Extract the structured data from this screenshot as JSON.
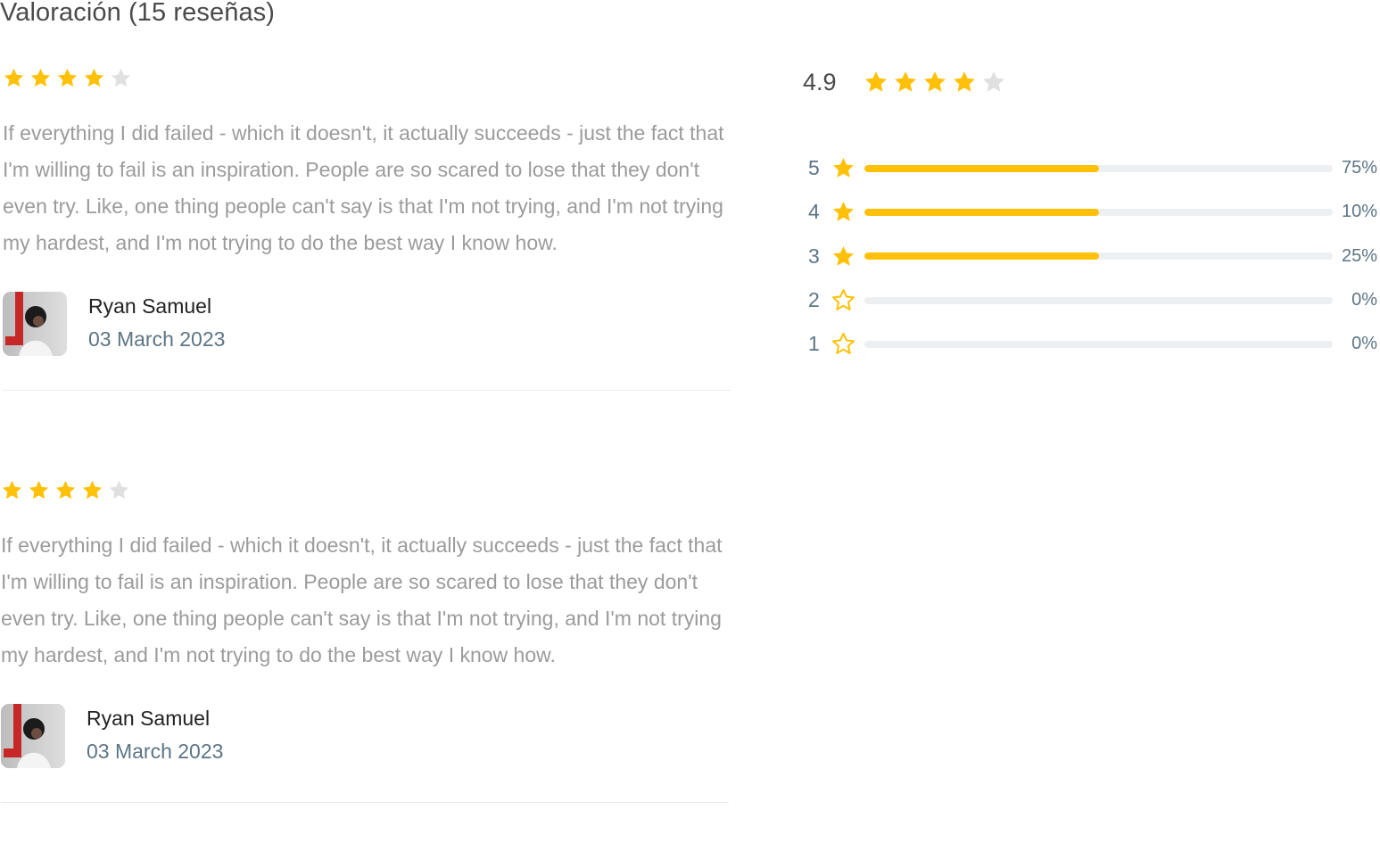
{
  "section": {
    "title": "Valoración (15 reseñas)"
  },
  "colors": {
    "star_filled": "#ffc107",
    "star_empty": "#e0e0e0",
    "bar_track": "#edf0f3",
    "date_text": "#5c7585",
    "body_text": "#9b9b9b"
  },
  "reviews": [
    {
      "rating": 4,
      "max_rating": 5,
      "text": "If everything I did failed - which it doesn't, it actually succeeds - just the fact that I'm willing to fail is an inspiration. People are so scared to lose that they don't even try. Like, one thing people can't say is that I'm not trying, and I'm not trying my hardest, and I'm not trying to do the best way I know how.",
      "author": "Ryan Samuel",
      "date": "03 March 2023",
      "avatar_icon": "avatar-photo"
    },
    {
      "rating": 4,
      "max_rating": 5,
      "text": "If everything I did failed - which it doesn't, it actually succeeds - just the fact that I'm willing to fail is an inspiration. People are so scared to lose that they don't even try. Like, one thing people can't say is that I'm not trying, and I'm not trying my hardest, and I'm not trying to do the best way I know how.",
      "author": "Ryan Samuel",
      "date": "03 March 2023",
      "avatar_icon": "avatar-photo"
    }
  ],
  "summary": {
    "average": "4.9",
    "average_stars": 4,
    "max_stars": 5,
    "distribution": [
      {
        "stars": "5",
        "percent_label": "75%",
        "fill_percent": 50,
        "icon": "star-filled-icon"
      },
      {
        "stars": "4",
        "percent_label": "10%",
        "fill_percent": 50,
        "icon": "star-filled-icon"
      },
      {
        "stars": "3",
        "percent_label": "25%",
        "fill_percent": 50,
        "icon": "star-filled-icon"
      },
      {
        "stars": "2",
        "percent_label": "0%",
        "fill_percent": 0,
        "icon": "star-outline-icon"
      },
      {
        "stars": "1",
        "percent_label": "0%",
        "fill_percent": 0,
        "icon": "star-outline-icon"
      }
    ]
  }
}
